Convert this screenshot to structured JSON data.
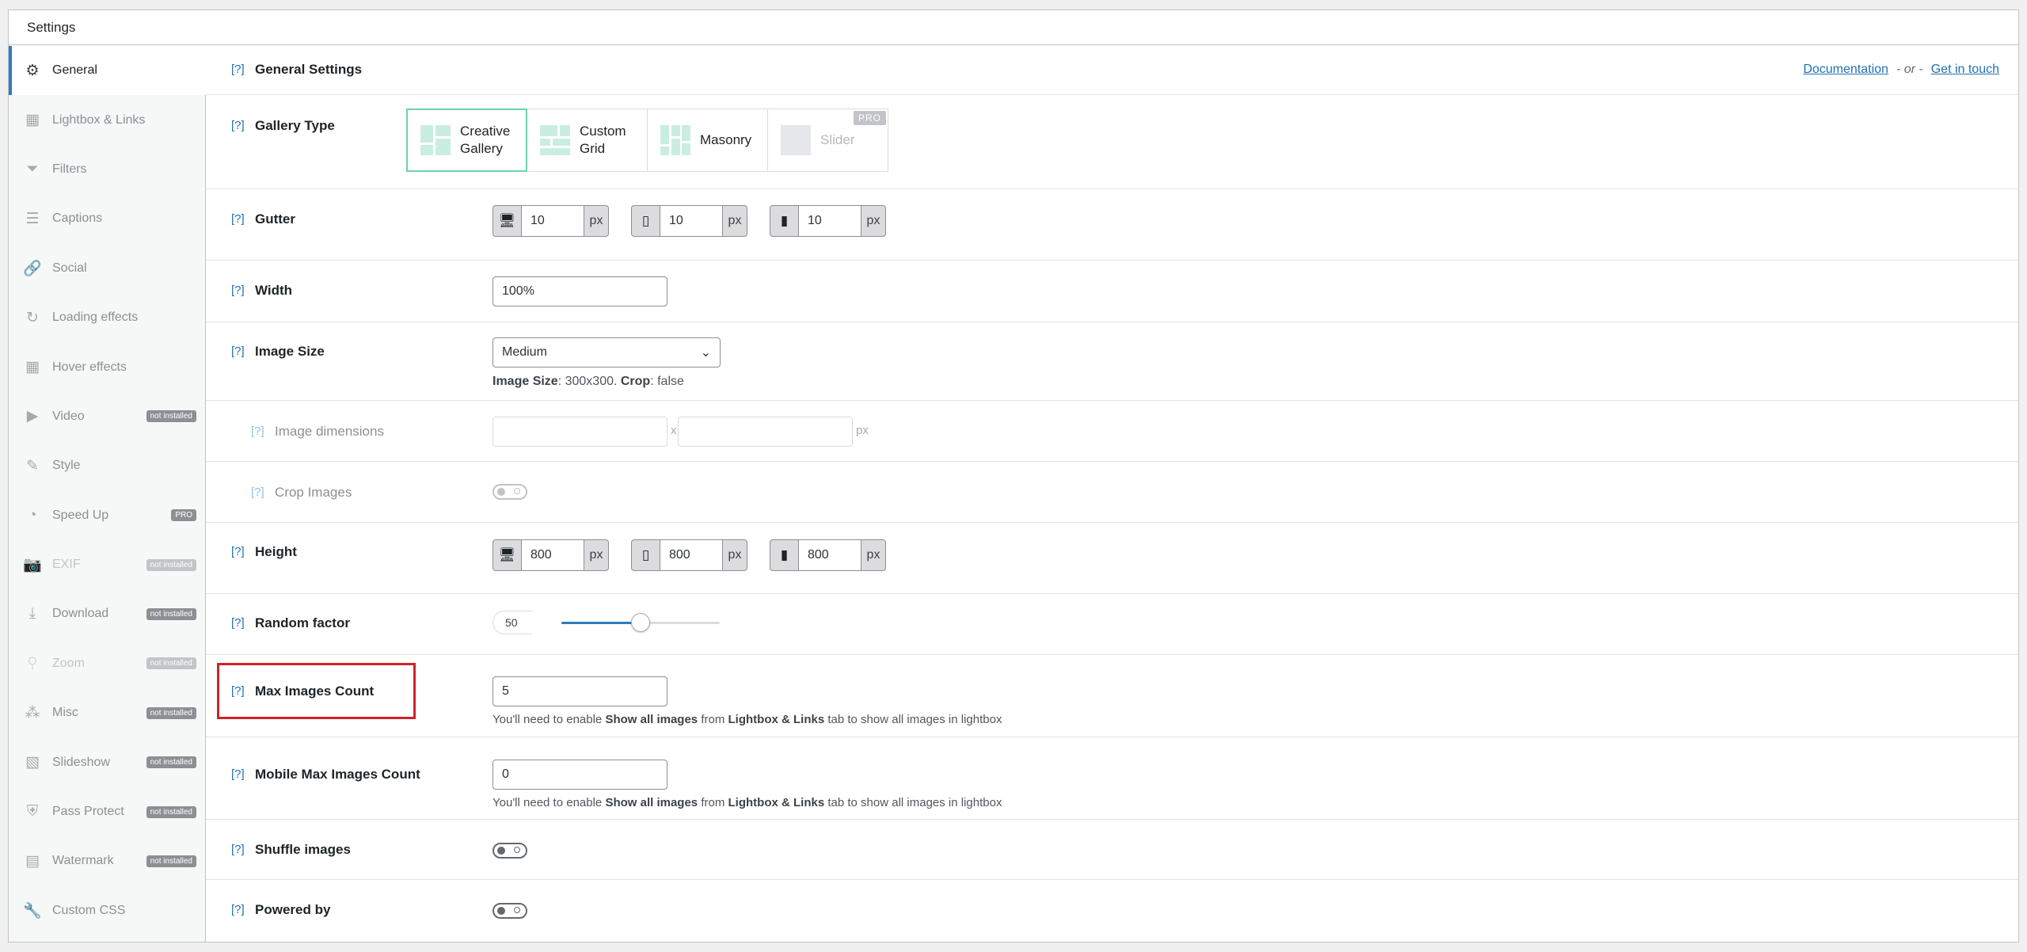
{
  "window": {
    "title": "Settings"
  },
  "sidebar": {
    "items": [
      {
        "label": "General",
        "icon": "gear-icon",
        "badge": "",
        "state": "active"
      },
      {
        "label": "Lightbox & Links",
        "icon": "grid-icon",
        "badge": "",
        "state": ""
      },
      {
        "label": "Filters",
        "icon": "filter-icon",
        "badge": "",
        "state": ""
      },
      {
        "label": "Captions",
        "icon": "text-lines-icon",
        "badge": "",
        "state": ""
      },
      {
        "label": "Social",
        "icon": "link-icon",
        "badge": "",
        "state": ""
      },
      {
        "label": "Loading effects",
        "icon": "refresh-icon",
        "badge": "",
        "state": ""
      },
      {
        "label": "Hover effects",
        "icon": "grid-icon",
        "badge": "",
        "state": ""
      },
      {
        "label": "Video",
        "icon": "video-icon",
        "badge": "not installed",
        "state": ""
      },
      {
        "label": "Style",
        "icon": "brush-icon",
        "badge": "",
        "state": ""
      },
      {
        "label": "Speed Up",
        "icon": "dashboard-icon",
        "badge": "PRO",
        "state": ""
      },
      {
        "label": "EXIF",
        "icon": "camera-icon",
        "badge": "not installed",
        "state": "disabled"
      },
      {
        "label": "Download",
        "icon": "download-icon",
        "badge": "not installed",
        "state": ""
      },
      {
        "label": "Zoom",
        "icon": "search-icon",
        "badge": "not installed",
        "state": "disabled"
      },
      {
        "label": "Misc",
        "icon": "circles-icon",
        "badge": "not installed",
        "state": ""
      },
      {
        "label": "Slideshow",
        "icon": "images-icon",
        "badge": "not installed",
        "state": ""
      },
      {
        "label": "Pass Protect",
        "icon": "shield-icon",
        "badge": "not installed",
        "state": ""
      },
      {
        "label": "Watermark",
        "icon": "watermark-icon",
        "badge": "not installed",
        "state": ""
      },
      {
        "label": "Custom CSS",
        "icon": "wrench-icon",
        "badge": "",
        "state": ""
      }
    ]
  },
  "header": {
    "help": "[?]",
    "title": "General Settings",
    "doc_link": "Documentation",
    "separator": "- or -",
    "contact_link": "Get in touch"
  },
  "gallery_type": {
    "label": "Gallery Type",
    "options": [
      {
        "label": "Creative\nGallery",
        "selected": true,
        "pro": false
      },
      {
        "label": "Custom\nGrid",
        "selected": false,
        "pro": false
      },
      {
        "label": "Masonry",
        "selected": false,
        "pro": false
      },
      {
        "label": "Slider",
        "selected": false,
        "pro": true
      }
    ],
    "pro_tag": "PRO"
  },
  "gutter": {
    "label": "Gutter",
    "desktop": "10",
    "tablet": "10",
    "mobile": "10",
    "unit": "px"
  },
  "width": {
    "label": "Width",
    "value": "100%"
  },
  "image_size": {
    "label": "Image Size",
    "selected": "Medium",
    "info_key1": "Image Size",
    "info_val1": ": 300x300. ",
    "info_key2": "Crop",
    "info_val2": ": false"
  },
  "image_dimensions": {
    "label": "Image dimensions",
    "sep": "x",
    "unit": "px"
  },
  "crop_images": {
    "label": "Crop Images",
    "enabled": false
  },
  "height": {
    "label": "Height",
    "desktop": "800",
    "tablet": "800",
    "mobile": "800",
    "unit": "px"
  },
  "random_factor": {
    "label": "Random factor",
    "value": "50",
    "level": 50
  },
  "max_images": {
    "label": "Max Images Count",
    "value": "5",
    "help_prefix": "You'll need to enable ",
    "help_bold1": "Show all images",
    "help_mid": " from ",
    "help_bold2": "Lightbox & Links",
    "help_suffix": " tab to show all images in lightbox"
  },
  "mobile_max_images": {
    "label": "Mobile Max Images Count",
    "value": "0",
    "help_prefix": "You'll need to enable ",
    "help_bold1": "Show all images",
    "help_mid": " from ",
    "help_bold2": "Lightbox & Links",
    "help_suffix": " tab to show all images in lightbox"
  },
  "shuffle_images": {
    "label": "Shuffle images",
    "enabled": false
  },
  "powered_by": {
    "label": "Powered by",
    "enabled": false
  },
  "colors": {
    "accent": "#2271b1",
    "selected_border": "#6bd1b1",
    "highlight": "#d0222a"
  }
}
